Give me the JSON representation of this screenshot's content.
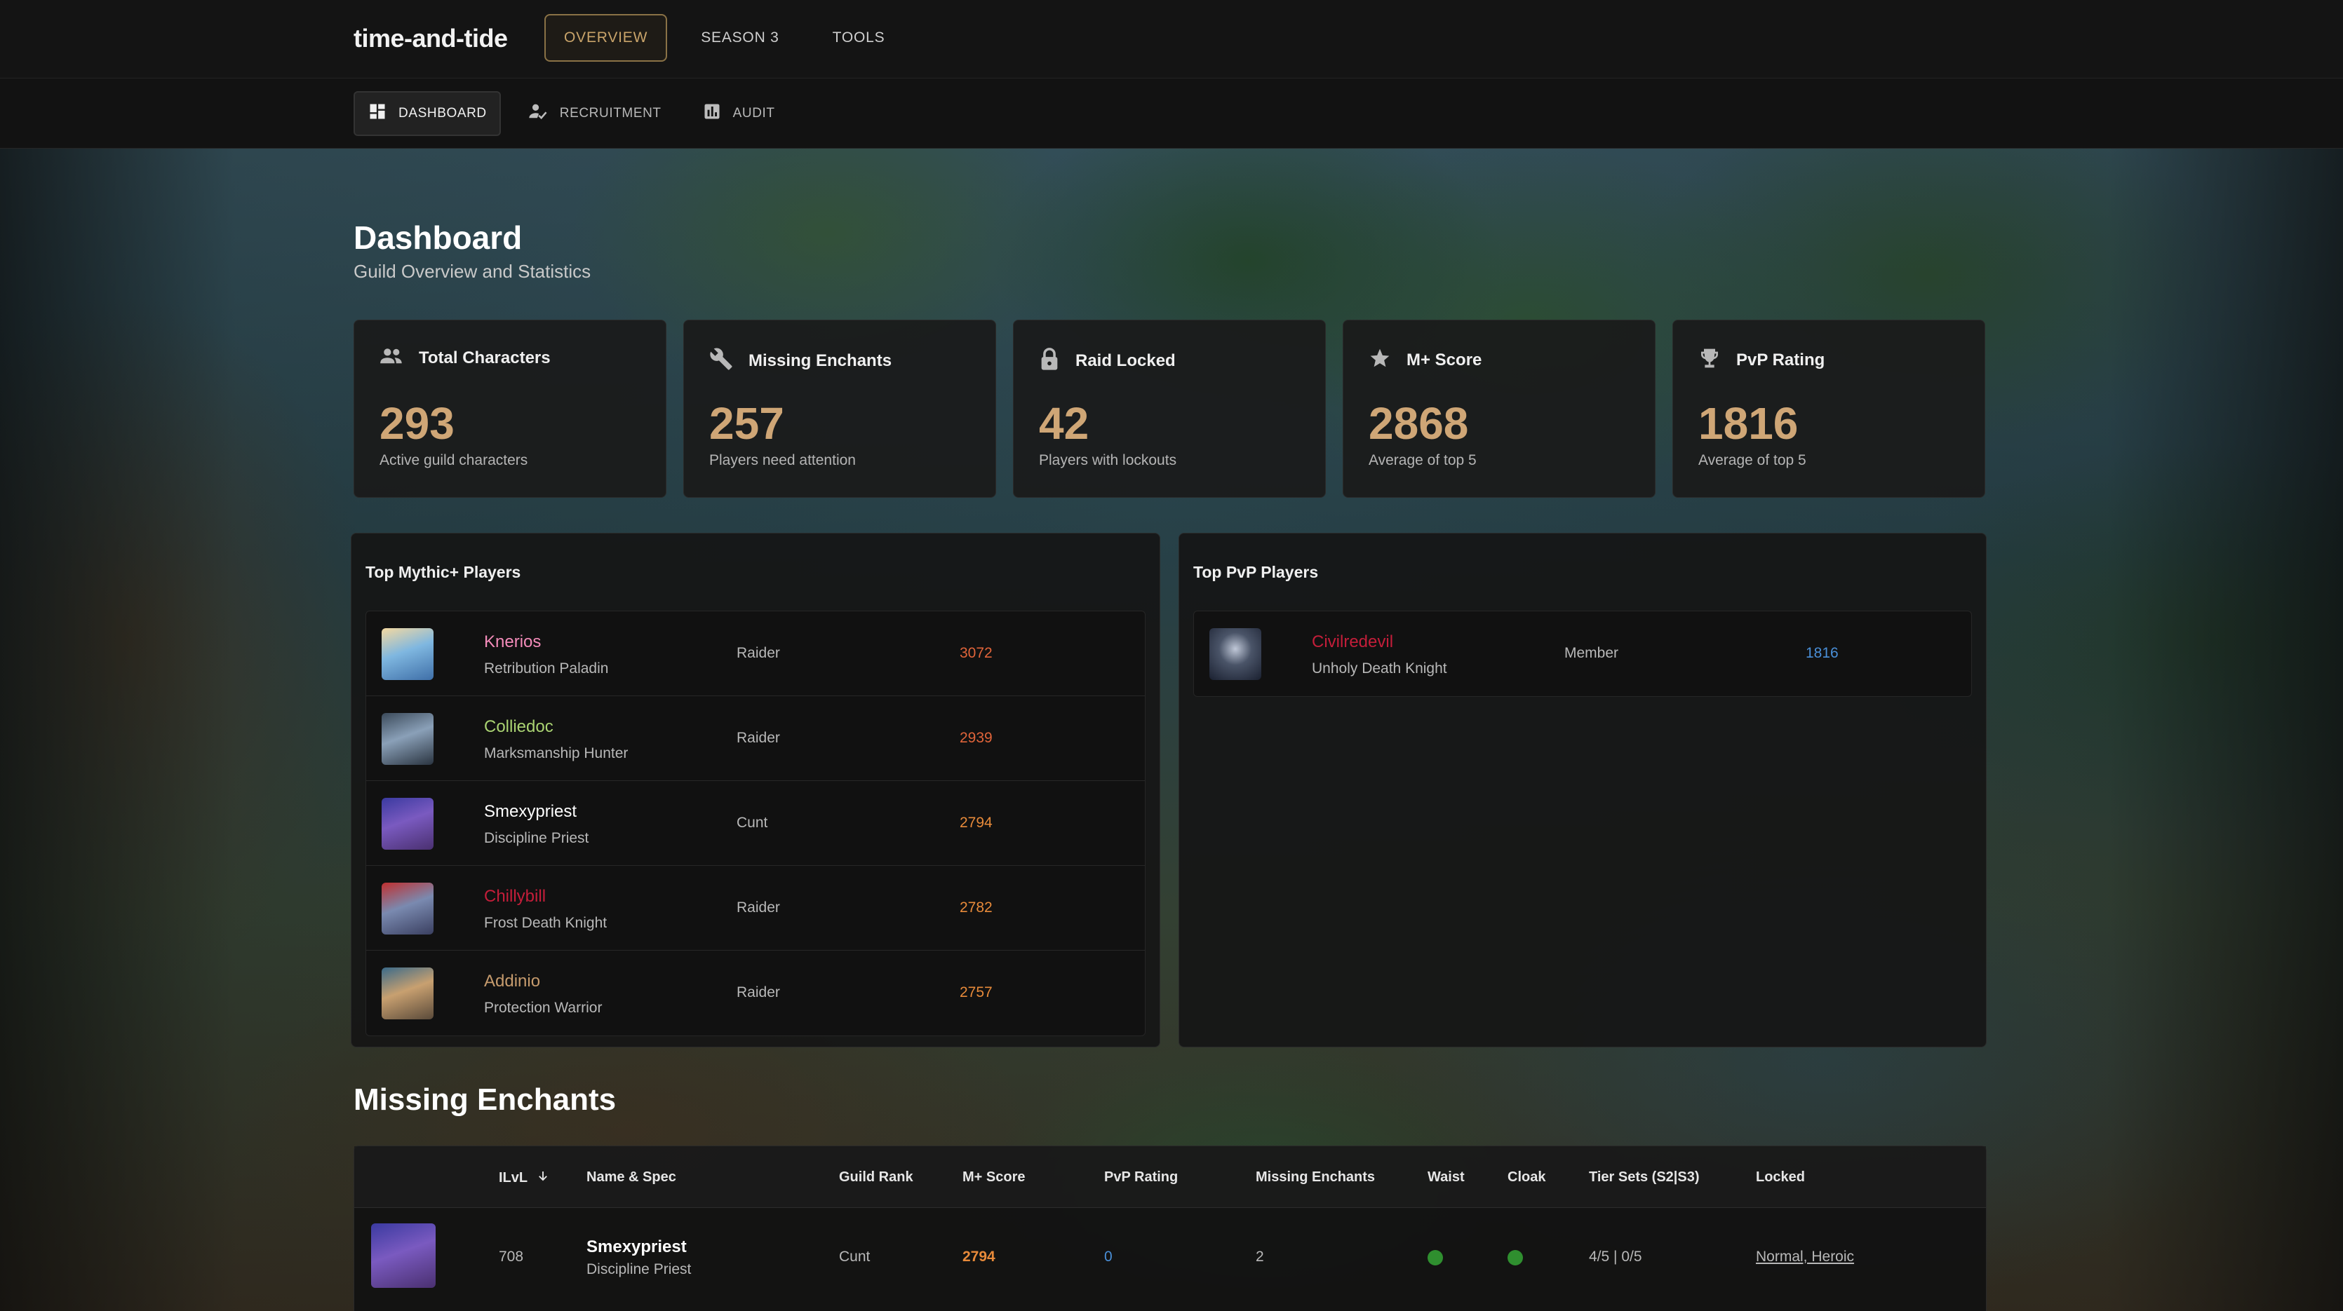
{
  "app": {
    "brand": "time-and-tide"
  },
  "top_nav": [
    {
      "label": "OVERVIEW",
      "active": true
    },
    {
      "label": "SEASON 3",
      "active": false
    },
    {
      "label": "TOOLS",
      "active": false
    }
  ],
  "sub_nav": [
    {
      "label": "DASHBOARD",
      "icon": "dashboard-icon",
      "active": true
    },
    {
      "label": "RECRUITMENT",
      "icon": "person-check-icon",
      "active": false
    },
    {
      "label": "AUDIT",
      "icon": "bar-chart-icon",
      "active": false
    }
  ],
  "page": {
    "title": "Dashboard",
    "subtitle": "Guild Overview and Statistics"
  },
  "stats": [
    {
      "label": "Total Characters",
      "value": "293",
      "desc": "Active guild characters",
      "icon": "people-icon"
    },
    {
      "label": "Missing Enchants",
      "value": "257",
      "desc": "Players need attention",
      "icon": "wrench-icon"
    },
    {
      "label": "Raid Locked",
      "value": "42",
      "desc": "Players with lockouts",
      "icon": "lock-icon"
    },
    {
      "label": "M+ Score",
      "value": "2868",
      "desc": "Average of top 5",
      "icon": "star-icon"
    },
    {
      "label": "PvP Rating",
      "value": "1816",
      "desc": "Average of top 5",
      "icon": "trophy-icon"
    }
  ],
  "top_mplus": {
    "title": "Top Mythic+ Players",
    "players": [
      {
        "name": "Knerios",
        "spec": "Retribution Paladin",
        "rank": "Raider",
        "score": "3072",
        "name_color": "#f48cba",
        "score_color": "#e0643a"
      },
      {
        "name": "Colliedoc",
        "spec": "Marksmanship Hunter",
        "rank": "Raider",
        "score": "2939",
        "name_color": "#aad372",
        "score_color": "#e0643a"
      },
      {
        "name": "Smexypriest",
        "spec": "Discipline Priest",
        "rank": "Cunt",
        "score": "2794",
        "name_color": "#ffffff",
        "score_color": "#e78a3a"
      },
      {
        "name": "Chillybill",
        "spec": "Frost Death Knight",
        "rank": "Raider",
        "score": "2782",
        "name_color": "#c41e3a",
        "score_color": "#e78a3a"
      },
      {
        "name": "Addinio",
        "spec": "Protection Warrior",
        "rank": "Raider",
        "score": "2757",
        "name_color": "#c69b6d",
        "score_color": "#e78a3a"
      }
    ]
  },
  "top_pvp": {
    "title": "Top PvP Players",
    "players": [
      {
        "name": "Civilredevil",
        "spec": "Unholy Death Knight",
        "rank": "Member",
        "score": "1816",
        "name_color": "#c41e3a",
        "score_color": "#4a8fd8"
      }
    ]
  },
  "missing_enchants": {
    "title": "Missing Enchants",
    "columns": [
      "ILvL",
      "Name & Spec",
      "Guild Rank",
      "M+ Score",
      "PvP Rating",
      "Missing Enchants",
      "Waist",
      "Cloak",
      "Tier Sets (S2|S3)",
      "Locked"
    ],
    "rows": [
      {
        "ilvl": "708",
        "name": "Smexypriest",
        "spec": "Discipline Priest",
        "rank": "Cunt",
        "mplus": "2794",
        "pvp": "0",
        "missing": "2",
        "tier": "4/5 | 0/5",
        "locked": "Normal, Heroic"
      }
    ]
  },
  "colors": {
    "accent": "#cfa676",
    "mplus_high": "#e0643a",
    "pvp_blue": "#4a8fd8",
    "ok_green": "#2f8f2f"
  }
}
